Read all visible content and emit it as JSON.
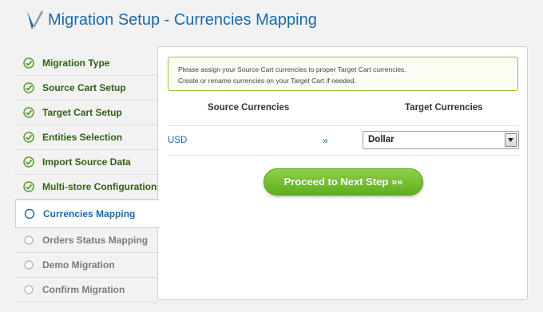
{
  "header": {
    "title": "Migration Setup - Currencies Mapping"
  },
  "sidebar": {
    "steps": [
      {
        "label": "Migration Type",
        "status": "done"
      },
      {
        "label": "Source Cart Setup",
        "status": "done"
      },
      {
        "label": "Target Cart Setup",
        "status": "done"
      },
      {
        "label": "Entities Selection",
        "status": "done"
      },
      {
        "label": "Import Source Data",
        "status": "done"
      },
      {
        "label": "Multi-store Configuration",
        "status": "done"
      },
      {
        "label": "Currencies Mapping",
        "status": "active"
      },
      {
        "label": "Orders Status Mapping",
        "status": "pending"
      },
      {
        "label": "Demo Migration",
        "status": "pending"
      },
      {
        "label": "Confirm Migration",
        "status": "pending"
      }
    ]
  },
  "notice": {
    "line1": "Please assign your Source Cart currencies to proper Target Cart currencies.",
    "line2": "Create or rename currencies on your Target Cart if needed."
  },
  "mapping": {
    "source_header": "Source Currencies",
    "target_header": "Target Currencies",
    "rows": [
      {
        "source": "USD",
        "arrow": "»",
        "target": "Dollar"
      }
    ]
  },
  "actions": {
    "next_label": "Proceed to Next Step »»"
  },
  "colors": {
    "accent_blue": "#1a6aad",
    "done_green": "#5a9a2a",
    "button_green": "#6fbf2a"
  }
}
